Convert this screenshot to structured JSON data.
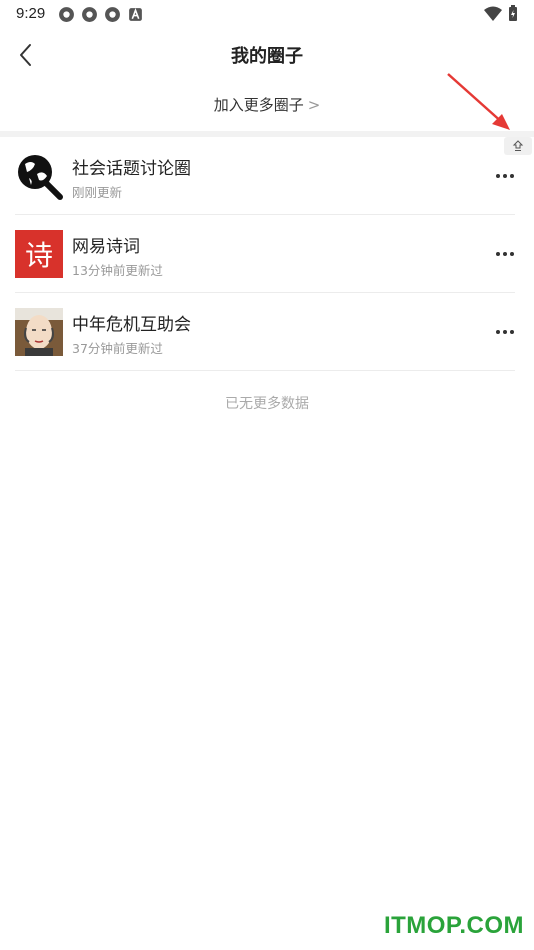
{
  "status_bar": {
    "time": "9:29"
  },
  "header": {
    "title": "我的圈子"
  },
  "join_more": {
    "label": "加入更多圈子",
    "chevron": ">"
  },
  "circles": [
    {
      "name": "社会话题讨论圈",
      "updated": "刚刚更新",
      "avatar_icon": "globe-magnifier-icon"
    },
    {
      "name": "网易诗词",
      "updated": "13分钟前更新过",
      "avatar_icon": "poetry-icon",
      "avatar_text": "诗"
    },
    {
      "name": "中年危机互助会",
      "updated": "37分钟前更新过",
      "avatar_icon": "bald-man-icon"
    }
  ],
  "footer": {
    "no_more_text": "已无更多数据"
  },
  "watermark": "ITMOP.COM",
  "colors": {
    "accent_red": "#e53935",
    "poetry_red": "#d8322b",
    "watermark_green": "#2aa33a"
  }
}
